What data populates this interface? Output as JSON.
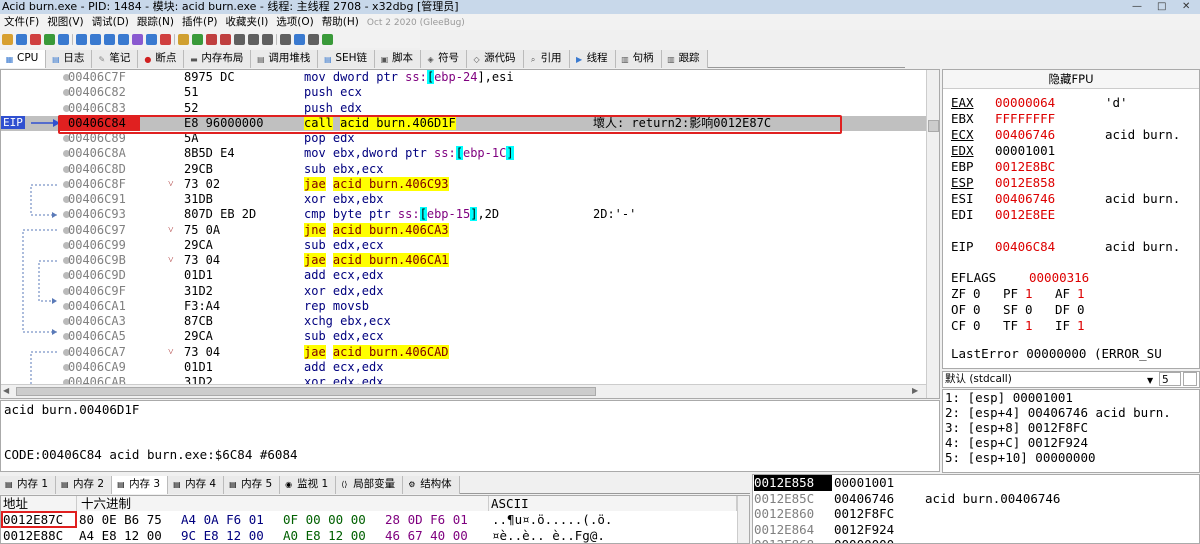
{
  "title_bar": {
    "text": "Acid burn.exe - PID: 1484 - 模块: acid burn.exe - 线程: 主线程 2708 - x32dbg [管理员]",
    "minimize": "—",
    "maximize": "□",
    "close": "✕"
  },
  "menu": [
    "文件(F)",
    "视图(V)",
    "调试(D)",
    "跟踪(N)",
    "插件(P)",
    "收藏夹(I)",
    "选项(O)",
    "帮助(H)"
  ],
  "build_date": "Oct 2 2020 (GleeBug)",
  "toolbar_icons": [
    "open-icon",
    "restart-icon",
    "close-file-icon",
    "run-icon",
    "pause-icon",
    "step-into-icon",
    "step-over-icon",
    "trace-into-icon",
    "trace-over-icon",
    "run-to-user-icon",
    "execute-till-return-icon",
    "animate-icon",
    "script-icon",
    "patch-icon",
    "comment-icon",
    "label-icon",
    "bookmark-icon",
    "function-icon",
    "hash-icon",
    "font-icon",
    "hex-icon",
    "calc-icon",
    "log-icon"
  ],
  "tabs": [
    "CPU",
    "日志",
    "笔记",
    "断点",
    "内存布局",
    "调用堆栈",
    "SEH链",
    "脚本",
    "符号",
    "源代码",
    "引用",
    "线程",
    "句柄",
    "跟踪"
  ],
  "disasm": {
    "eip_label": "EIP",
    "rows": [
      {
        "addr": "00406C7F",
        "bytes": "8975 DC",
        "ins": [
          [
            "mov dword ptr ",
            "kw"
          ],
          [
            "ss:",
            "ptr"
          ],
          [
            "[",
            "hl"
          ],
          [
            "ebp-24",
            "ptr"
          ],
          [
            "]",
            ""
          ],
          [
            ",esi",
            ""
          ]
        ],
        "cmt": ""
      },
      {
        "addr": "00406C82",
        "bytes": "51",
        "ins": [
          [
            "push ecx",
            "push"
          ]
        ],
        "cmt": ""
      },
      {
        "addr": "00406C83",
        "bytes": "52",
        "ins": [
          [
            "push edx",
            "push"
          ]
        ],
        "cmt": ""
      },
      {
        "addr": "00406C84",
        "bytes": "E8 96000000",
        "ins": [
          [
            "call",
            "call"
          ],
          [
            " ",
            ""
          ],
          [
            "acid burn.406D1F",
            "call"
          ]
        ],
        "cmt": "壞人: return2:影响0012E87C"
      },
      {
        "addr": "00406C89",
        "bytes": "5A",
        "ins": [
          [
            "pop edx",
            "push"
          ]
        ],
        "cmt": ""
      },
      {
        "addr": "00406C8A",
        "bytes": "8B5D E4",
        "ins": [
          [
            "mov ebx,dword ptr ",
            "kw"
          ],
          [
            "ss:",
            "ptr"
          ],
          [
            "[",
            "hl"
          ],
          [
            "ebp-1C",
            "ptr"
          ],
          [
            "]",
            "hl"
          ]
        ],
        "cmt": ""
      },
      {
        "addr": "00406C8D",
        "bytes": "29CB",
        "ins": [
          [
            "sub ebx,ecx",
            "kw"
          ]
        ],
        "cmt": ""
      },
      {
        "addr": "00406C8F",
        "bytes": "73 02",
        "ins": [
          [
            "jae",
            "jmp"
          ],
          [
            " ",
            ""
          ],
          [
            "acid burn.406C93",
            "jmp"
          ]
        ],
        "cmt": ""
      },
      {
        "addr": "00406C91",
        "bytes": "31DB",
        "ins": [
          [
            "xor ebx,ebx",
            "kw"
          ]
        ],
        "cmt": ""
      },
      {
        "addr": "00406C93",
        "bytes": "807D EB 2D",
        "ins": [
          [
            "cmp byte ptr ",
            "kw"
          ],
          [
            "ss:",
            "ptr"
          ],
          [
            "[",
            "hl"
          ],
          [
            "ebp-15",
            "ptr"
          ],
          [
            "]",
            "hl"
          ],
          [
            ",2D",
            ""
          ]
        ],
        "cmt": "2D:'-'"
      },
      {
        "addr": "00406C97",
        "bytes": "75 0A",
        "ins": [
          [
            "jne",
            "jmp"
          ],
          [
            " ",
            ""
          ],
          [
            "acid burn.406CA3",
            "jmp"
          ]
        ],
        "cmt": ""
      },
      {
        "addr": "00406C99",
        "bytes": "29CA",
        "ins": [
          [
            "sub edx,ecx",
            "kw"
          ]
        ],
        "cmt": ""
      },
      {
        "addr": "00406C9B",
        "bytes": "73 04",
        "ins": [
          [
            "jae",
            "jmp"
          ],
          [
            " ",
            ""
          ],
          [
            "acid burn.406CA1",
            "jmp"
          ]
        ],
        "cmt": ""
      },
      {
        "addr": "00406C9D",
        "bytes": "01D1",
        "ins": [
          [
            "add ecx,edx",
            "kw"
          ]
        ],
        "cmt": ""
      },
      {
        "addr": "00406C9F",
        "bytes": "31D2",
        "ins": [
          [
            "xor edx,edx",
            "kw"
          ]
        ],
        "cmt": ""
      },
      {
        "addr": "00406CA1",
        "bytes": "F3:A4",
        "ins": [
          [
            "rep movsb",
            "kw"
          ]
        ],
        "cmt": ""
      },
      {
        "addr": "00406CA3",
        "bytes": "87CB",
        "ins": [
          [
            "xchg ebx,ecx",
            "kw"
          ]
        ],
        "cmt": ""
      },
      {
        "addr": "00406CA5",
        "bytes": "29CA",
        "ins": [
          [
            "sub edx,ecx",
            "kw"
          ]
        ],
        "cmt": ""
      },
      {
        "addr": "00406CA7",
        "bytes": "73 04",
        "ins": [
          [
            "jae",
            "jmp"
          ],
          [
            " ",
            ""
          ],
          [
            "acid burn.406CAD",
            "jmp"
          ]
        ],
        "cmt": ""
      },
      {
        "addr": "00406CA9",
        "bytes": "01D1",
        "ins": [
          [
            "add ecx,edx",
            "kw"
          ]
        ],
        "cmt": ""
      },
      {
        "addr": "00406CAB",
        "bytes": "31D2",
        "ins": [
          [
            "xor edx,edx",
            "kw"
          ]
        ],
        "cmt": ""
      }
    ]
  },
  "info": {
    "line1": "acid burn.00406D1F",
    "line2": "CODE:00406C84 acid burn.exe:$6C84 #6084"
  },
  "registers": {
    "header": "隐藏FPU",
    "gp": [
      {
        "n": "EAX",
        "v": "00000064",
        "c": "'d'",
        "red": true,
        "ul": true
      },
      {
        "n": "EBX",
        "v": "FFFFFFFF",
        "c": "",
        "red": true,
        "ul": false
      },
      {
        "n": "ECX",
        "v": "00406746",
        "c": "acid burn.",
        "red": true,
        "ul": true
      },
      {
        "n": "EDX",
        "v": "00001001",
        "c": "",
        "red": false,
        "ul": true
      },
      {
        "n": "EBP",
        "v": "0012E8BC",
        "c": "",
        "red": true,
        "ul": false
      },
      {
        "n": "ESP",
        "v": "0012E858",
        "c": "",
        "red": true,
        "ul": true
      },
      {
        "n": "ESI",
        "v": "00406746",
        "c": "acid burn.",
        "red": true,
        "ul": false
      },
      {
        "n": "EDI",
        "v": "0012E8EE",
        "c": "",
        "red": true,
        "ul": false
      }
    ],
    "eip": {
      "n": "EIP",
      "v": "00406C84",
      "c": "acid burn."
    },
    "eflags": {
      "n": "EFLAGS",
      "v": "00000316"
    },
    "flags_line1": [
      "ZF",
      "0",
      "PF",
      "1",
      "AF",
      "1"
    ],
    "flags_line2": [
      "OF",
      "0",
      "SF",
      "0",
      "DF",
      "0"
    ],
    "flags_line3": [
      "CF",
      "0",
      "TF",
      "1",
      "IF",
      "1"
    ],
    "last_error": "LastError  00000000 (ERROR_SU"
  },
  "callconv": {
    "value": "默认 (stdcall)",
    "count": "5",
    "lock": "解锁"
  },
  "stack_args": [
    "1: [esp] 00001001",
    "2: [esp+4] 00406746 acid burn.",
    "3: [esp+8] 0012F8FC",
    "4: [esp+C] 0012F924",
    "5: [esp+10] 00000000"
  ],
  "mem_tabs": [
    "内存 1",
    "内存 2",
    "内存 3",
    "内存 4",
    "内存 5",
    "监视 1",
    "局部变量",
    "结构体"
  ],
  "dump": {
    "headers": [
      "地址",
      "十六进制",
      "ASCII"
    ],
    "rows": [
      {
        "addr": "0012E87C",
        "hex": [
          [
            "80 0E B6 75",
            ""
          ],
          [
            "A4 0A F6 01",
            ""
          ],
          [
            "0F 00 00 00",
            ""
          ],
          [
            "28 0D F6 01",
            ""
          ]
        ],
        "ascii": "..¶u¤.ö.....(.ö."
      },
      {
        "addr": "0012E88C",
        "hex": [
          [
            "A4 E8 12 00",
            ""
          ],
          [
            "9C E8 12 00",
            ""
          ],
          [
            "A0 E8 12 00",
            ""
          ],
          [
            "46 67 40 00",
            ""
          ]
        ],
        "ascii": "¤è..è.. è..Fg@."
      }
    ]
  },
  "stack_view": [
    {
      "a": "0012E858",
      "v": "00001001",
      "c": ""
    },
    {
      "a": "0012E85C",
      "v": "00406746",
      "c": "acid burn.00406746"
    },
    {
      "a": "0012E860",
      "v": "0012F8FC",
      "c": ""
    },
    {
      "a": "0012E864",
      "v": "0012F924",
      "c": ""
    },
    {
      "a": "0012E868",
      "v": "00000000",
      "c": ""
    }
  ]
}
